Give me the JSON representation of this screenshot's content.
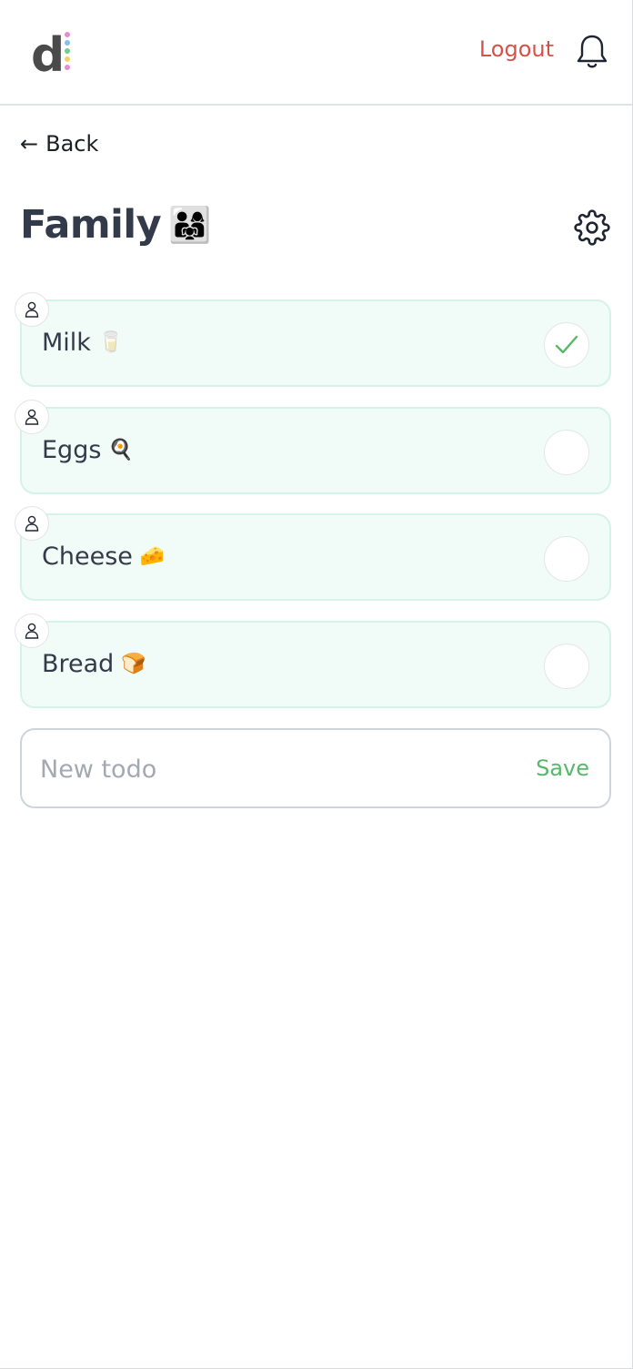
{
  "header": {
    "logout_label": "Logout",
    "logo_letter": "d",
    "logo_dot_colors": [
      "#e88bd7",
      "#7fc2f0",
      "#6fd08c",
      "#f3d35f"
    ]
  },
  "nav": {
    "back_arrow": "←",
    "back_label": "Back"
  },
  "list": {
    "title": "Family",
    "title_emoji": "👨‍👩‍👧"
  },
  "todos": [
    {
      "label": "Milk",
      "emoji": "🥛",
      "done": true
    },
    {
      "label": "Eggs",
      "emoji": "🍳",
      "done": false
    },
    {
      "label": "Cheese",
      "emoji": "🧀",
      "done": false
    },
    {
      "label": "Bread",
      "emoji": "🍞",
      "done": false
    }
  ],
  "composer": {
    "placeholder": "New todo",
    "value": "",
    "save_label": "Save"
  },
  "colors": {
    "accent_red": "#d65148",
    "accent_green": "#57b86a",
    "item_bg": "#f1fbf7",
    "item_border": "#d5f3e6",
    "text": "#333a4a"
  },
  "icons": {
    "bell": "bell-icon",
    "gear": "gear-icon",
    "avatar": "user-icon",
    "check": "checkmark-icon"
  }
}
